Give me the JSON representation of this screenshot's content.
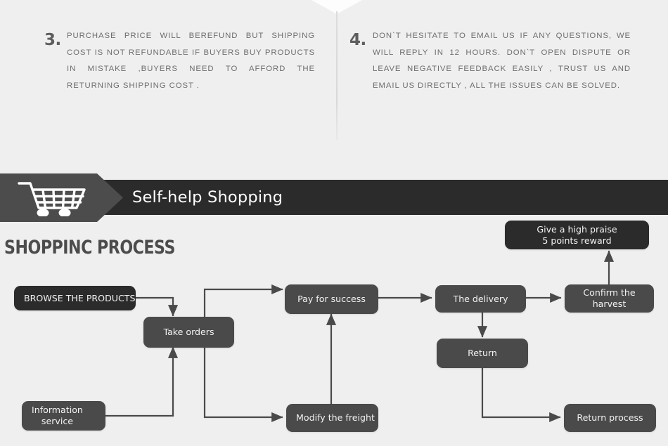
{
  "policies": [
    {
      "number": "3.",
      "text": "PURCHASE PRICE WILL BEREFUND BUT SHIPPING COST IS NOT REFUNDABLE IF BUYERS BUY PRODUCTS IN MISTAKE ,BUYERS NEED TO AFFORD THE RETURNING SHIPPING COST ."
    },
    {
      "number": "4.",
      "text": "DON`T HESITATE TO EMAIL US IF ANY QUESTIONS, WE WILL REPLY IN 12 HOURS. DON`T OPEN DISPUTE OR LEAVE NEGATIVE FEEDBACK EASILY , TRUST US AND EMAIL US DIRECTLY , ALL THE ISSUES CAN BE SOLVED."
    }
  ],
  "banner": {
    "title": "Self-help Shopping",
    "icon": "shopping-cart-icon",
    "background_color": "#2b2b2b",
    "plate_color": "#4c4c4c"
  },
  "section": {
    "heading": "SHOPPINC PROCESS"
  },
  "flow": {
    "node_color": "#4a4a4a",
    "node_dark_color": "#2b2b2b",
    "edge_color": "#4a4a4a",
    "nodes": [
      {
        "id": "browse",
        "label": "BROWSE THE PRODUCTS"
      },
      {
        "id": "take_orders",
        "label": "Take orders"
      },
      {
        "id": "information",
        "label": "Information\nservice"
      },
      {
        "id": "pay",
        "label": "Pay for success"
      },
      {
        "id": "modify",
        "label": "Modify the freight"
      },
      {
        "id": "delivery",
        "label": "The delivery"
      },
      {
        "id": "return",
        "label": "Return"
      },
      {
        "id": "confirm",
        "label": "Confirm the\nharvest"
      },
      {
        "id": "praise",
        "label": "Give a high praise\n5 points reward"
      },
      {
        "id": "return_proc",
        "label": "Return process"
      }
    ]
  }
}
